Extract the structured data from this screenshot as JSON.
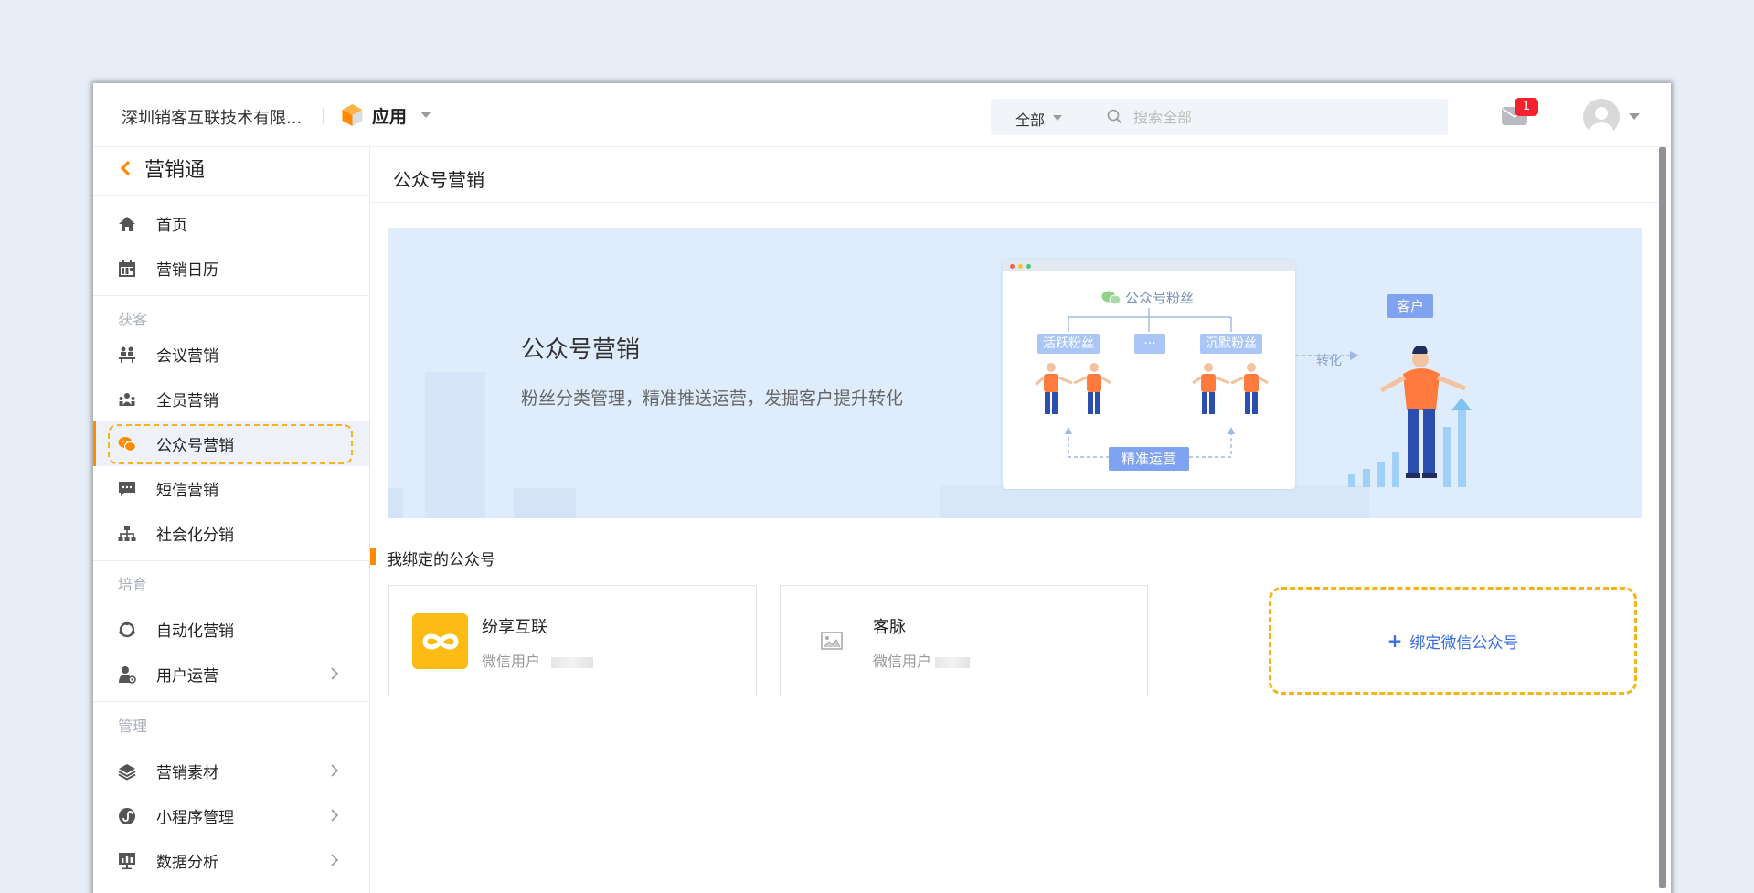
{
  "topbar": {
    "company": "深圳销客互联技术有限...",
    "app_label": "应用",
    "search_scope": "全部",
    "search_placeholder": "搜索全部",
    "notification_count": "1"
  },
  "sidebar": {
    "back_label": "营销通",
    "items_top": [
      {
        "label": "首页",
        "icon": "home-icon"
      },
      {
        "label": "营销日历",
        "icon": "calendar-icon"
      }
    ],
    "group_acquire": "获客",
    "items_acquire": [
      {
        "label": "会议营销",
        "icon": "meeting-icon"
      },
      {
        "label": "全员营销",
        "icon": "team-icon"
      },
      {
        "label": "公众号营销",
        "icon": "wechat-icon",
        "active": true
      },
      {
        "label": "短信营销",
        "icon": "sms-icon"
      },
      {
        "label": "社会化分销",
        "icon": "org-tree-icon"
      }
    ],
    "group_nurture": "培育",
    "items_nurture": [
      {
        "label": "自动化营销",
        "icon": "automation-icon"
      },
      {
        "label": "用户运营",
        "icon": "user-ops-icon",
        "chevron": true
      }
    ],
    "group_manage": "管理",
    "items_manage": [
      {
        "label": "营销素材",
        "icon": "layers-icon",
        "chevron": true
      },
      {
        "label": "小程序管理",
        "icon": "miniprogram-icon",
        "chevron": true
      },
      {
        "label": "数据分析",
        "icon": "chart-icon",
        "chevron": true
      }
    ]
  },
  "main": {
    "page_title": "公众号营销",
    "banner": {
      "title": "公众号营销",
      "subtitle": "粉丝分类管理，精准推送运营，发掘客户提升转化",
      "illus_head": "公众号粉丝",
      "chip_active": "活跃粉丝",
      "chip_more": "···",
      "chip_silent": "沉默粉丝",
      "chip_ops": "精准运营",
      "convert": "转化",
      "customer": "客户"
    },
    "section_title": "我绑定的公众号",
    "accounts": [
      {
        "name": "纷享互联",
        "sub": "微信用户"
      },
      {
        "name": "客脉",
        "sub": "微信用户"
      }
    ],
    "bind_label": "绑定微信公众号"
  },
  "colors": {
    "accent": "#ff8a00",
    "highlight_dash": "#f5b31a",
    "link_blue": "#3b6fe0",
    "badge_red": "#f5222d"
  }
}
